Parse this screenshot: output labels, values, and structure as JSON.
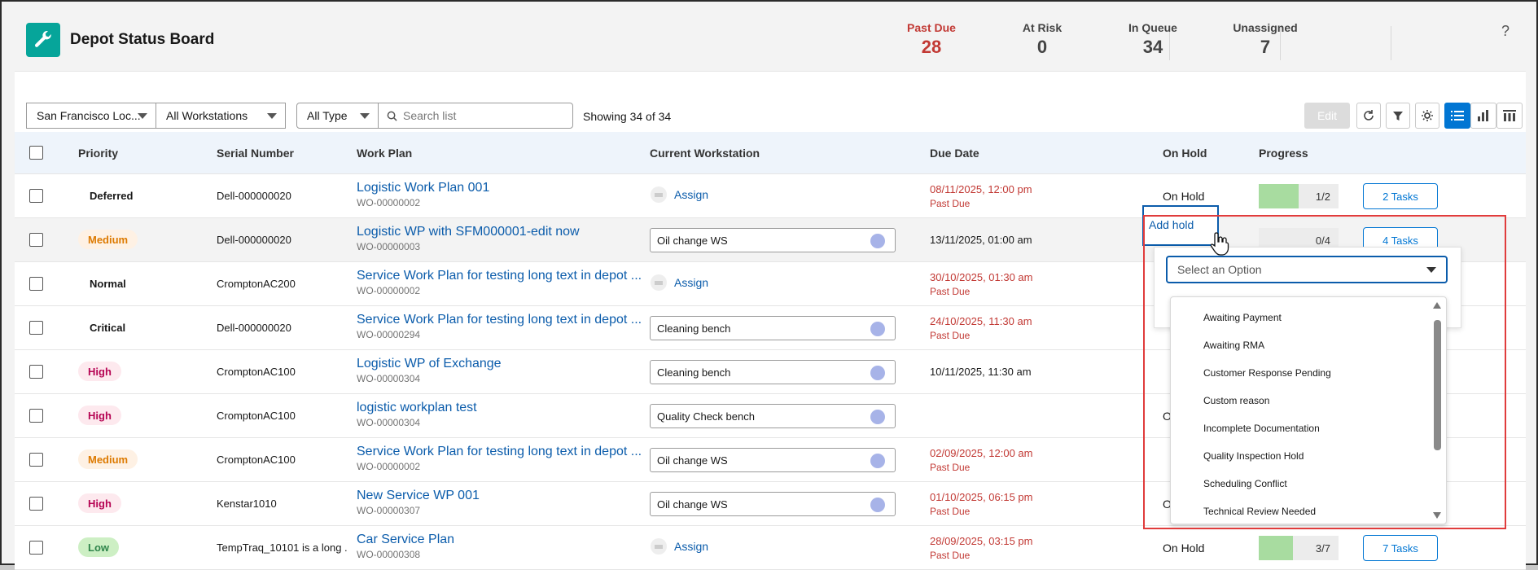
{
  "header": {
    "title": "Depot Status Board",
    "metrics": [
      {
        "label": "Past Due",
        "value": "28"
      },
      {
        "label": "At Risk",
        "value": "0"
      },
      {
        "label": "In Queue",
        "value": "34"
      },
      {
        "label": "Unassigned",
        "value": "7"
      }
    ],
    "help": "?"
  },
  "toolbar": {
    "location": "San Francisco Loc...",
    "workstations": "All Workstations",
    "type": "All Type",
    "search_placeholder": "Search list",
    "showing": "Showing 34 of 34",
    "edit_label": "Edit"
  },
  "columns": {
    "priority": "Priority",
    "serial": "Serial Number",
    "workplan": "Work Plan",
    "workstation": "Current Workstation",
    "due": "Due Date",
    "onhold": "On Hold",
    "progress": "Progress"
  },
  "rows": [
    {
      "priority": "Deferred",
      "serial": "Dell-000000020",
      "wp": "Logistic Work Plan 001",
      "wo": "WO-00000002",
      "ws": "",
      "assign": "Assign",
      "due": "08/11/2025, 12:00 pm",
      "past_due": "Past Due",
      "onhold": "On Hold",
      "progress": "1/2",
      "progress_fraction": 0.5,
      "tasks": "2 Tasks"
    },
    {
      "priority": "Medium",
      "serial": "Dell-000000020",
      "wp": "Logistic WP with SFM000001-edit now",
      "wo": "WO-00000003",
      "ws": "Oil change WS",
      "due": "13/11/2025, 01:00 am",
      "onhold": "Add hold",
      "progress": "0/4",
      "progress_fraction": 0,
      "tasks": "4 Tasks"
    },
    {
      "priority": "Normal",
      "serial": "CromptonAC200",
      "wp": "Service Work Plan for testing long text in depot ...",
      "wo": "WO-00000002",
      "assign": "Assign",
      "due": "30/10/2025, 01:30 am",
      "past_due": "Past Due"
    },
    {
      "priority": "Critical",
      "serial": "Dell-000000020",
      "wp": "Service Work Plan for testing long text in depot ...",
      "wo": "WO-00000294",
      "ws": "Cleaning bench",
      "due": "24/10/2025, 11:30 am",
      "past_due": "Past Due"
    },
    {
      "priority": "High",
      "serial": "CromptonAC100",
      "wp": "Logistic WP of Exchange",
      "wo": "WO-00000304",
      "ws": "Cleaning bench",
      "due": "10/11/2025, 11:30 am"
    },
    {
      "priority": "High",
      "serial": "CromptonAC100",
      "wp": "logistic workplan test",
      "wo": "WO-00000304",
      "ws": "Quality Check bench",
      "due": "",
      "onhold_partial": "O"
    },
    {
      "priority": "Medium",
      "serial": "CromptonAC100",
      "wp": "Service Work Plan for testing long text in depot ...",
      "wo": "WO-00000002",
      "ws": "Oil change WS",
      "due": "02/09/2025, 12:00 am",
      "past_due": "Past Due"
    },
    {
      "priority": "High",
      "serial": "Kenstar1010",
      "wp": "New Service WP 001",
      "wo": "WO-00000307",
      "ws": "Oil change WS",
      "due": "01/10/2025, 06:15 pm",
      "past_due": "Past Due",
      "onhold_partial": "O"
    },
    {
      "priority": "Low",
      "serial": "TempTraq_10101 is a long ...",
      "wp": "Car Service Plan",
      "wo": "WO-00000308",
      "assign": "Assign",
      "due": "28/09/2025, 03:15 pm",
      "past_due": "Past Due",
      "onhold": "On Hold",
      "progress": "3/7",
      "progress_fraction": 0.4286,
      "tasks": "7 Tasks"
    }
  ],
  "hold_popover": {
    "placeholder": "Select an Option",
    "options": [
      "Awaiting Payment",
      "Awaiting RMA",
      "Customer Response Pending",
      "Custom reason",
      "Incomplete Documentation",
      "Quality Inspection Hold",
      "Scheduling Conflict",
      "Technical Review Needed"
    ]
  },
  "colors": {
    "past_due": "#c23934",
    "link": "#0b5cab",
    "brand": "#0176d3",
    "teal": "#06a59a"
  }
}
